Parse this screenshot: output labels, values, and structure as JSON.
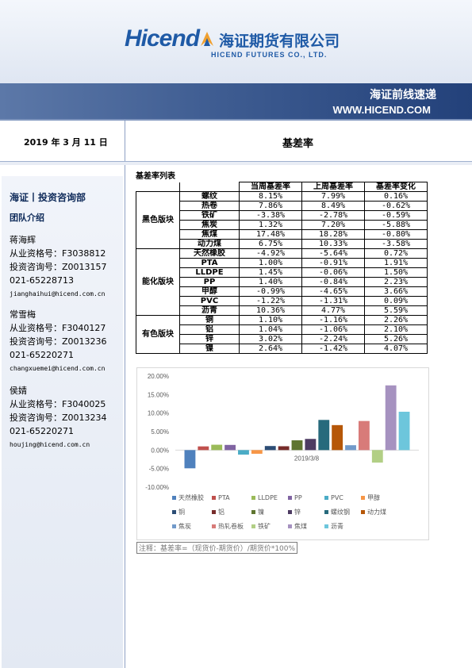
{
  "header": {
    "logo_en": "Hicend",
    "logo_cn": "海证期货有限公司",
    "logo_sub": "HICEND  FUTURES  CO.,  LTD.",
    "band_title": "海证前线速递",
    "band_url": "WWW.HICEND.COM"
  },
  "report": {
    "date": "2019 年 3 月 11 日",
    "title": "基差率"
  },
  "sidebar": {
    "dept": "海证丨投资咨询部",
    "team": "团队介绍",
    "members": [
      {
        "name": "蒋海辉",
        "qual": "从业资格号：F3038812",
        "consult": "投资咨询号：Z0013157",
        "phone": "021-65228713",
        "email": "jianghaihui@hicend.com.cn"
      },
      {
        "name": "常雪梅",
        "qual": "从业资格号：F3040127",
        "consult": "投资咨询号：Z0013236",
        "phone": "021-65220271",
        "email": "changxuemei@hicend.com.cn"
      },
      {
        "name": "侯婧",
        "qual": "从业资格号：F3040025",
        "consult": "投资咨询号：Z0013234",
        "phone": "021-65220271",
        "email": "houjing@hicend.com.cn"
      }
    ]
  },
  "table": {
    "title": "基差率列表",
    "headers": [
      "当周基差率",
      "上周基差率",
      "基差率变化"
    ],
    "groups": [
      {
        "name": "黑色版块",
        "rows": [
          {
            "name": "螺纹",
            "cur": "8.15%",
            "prev": "7.99%",
            "chg": "0.16%"
          },
          {
            "name": "热卷",
            "cur": "7.86%",
            "prev": "8.49%",
            "chg": "-0.62%"
          },
          {
            "name": "铁矿",
            "cur": "-3.38%",
            "prev": "-2.78%",
            "chg": "-0.59%"
          },
          {
            "name": "焦炭",
            "cur": "1.32%",
            "prev": "7.20%",
            "chg": "-5.88%"
          },
          {
            "name": "焦煤",
            "cur": "17.48%",
            "prev": "18.28%",
            "chg": "-0.80%"
          },
          {
            "name": "动力煤",
            "cur": "6.75%",
            "prev": "10.33%",
            "chg": "-3.58%"
          }
        ]
      },
      {
        "name": "能化版块",
        "rows": [
          {
            "name": "天然橡胶",
            "cur": "-4.92%",
            "prev": "-5.64%",
            "chg": "0.72%"
          },
          {
            "name": "PTA",
            "cur": "1.00%",
            "prev": "-0.91%",
            "chg": "1.91%"
          },
          {
            "name": "LLDPE",
            "cur": "1.45%",
            "prev": "-0.06%",
            "chg": "1.50%"
          },
          {
            "name": "PP",
            "cur": "1.40%",
            "prev": "-0.84%",
            "chg": "2.23%"
          },
          {
            "name": "甲醇",
            "cur": "-0.99%",
            "prev": "-4.65%",
            "chg": "3.66%"
          },
          {
            "name": "PVC",
            "cur": "-1.22%",
            "prev": "-1.31%",
            "chg": "0.09%"
          },
          {
            "name": "沥青",
            "cur": "10.36%",
            "prev": "4.77%",
            "chg": "5.59%"
          }
        ]
      },
      {
        "name": "有色版块",
        "rows": [
          {
            "name": "铜",
            "cur": "1.10%",
            "prev": "-1.16%",
            "chg": "2.26%"
          },
          {
            "name": "铝",
            "cur": "1.04%",
            "prev": "-1.06%",
            "chg": "2.10%"
          },
          {
            "name": "锌",
            "cur": "3.02%",
            "prev": "-2.24%",
            "chg": "5.26%"
          },
          {
            "name": "镍",
            "cur": "2.64%",
            "prev": "-1.42%",
            "chg": "4.07%"
          }
        ]
      }
    ]
  },
  "note": "注释：基差率=（现货价-期货价）/期货价*100%",
  "chart_data": {
    "type": "bar",
    "categories": [
      "2019/3/8"
    ],
    "ylim": [
      -10,
      20
    ],
    "yticks": [
      "20.00%",
      "15.00%",
      "10.00%",
      "5.00%",
      "0.00%",
      "-5.00%",
      "-10.00%"
    ],
    "yticks_values": [
      20,
      15,
      10,
      5,
      0,
      -5,
      -10
    ],
    "grid": false,
    "legend_position": "bottom",
    "series": [
      {
        "name": "天然橡胶",
        "values": [
          -4.92
        ],
        "color": "#4f81bd"
      },
      {
        "name": "PTA",
        "values": [
          1.0
        ],
        "color": "#c0504d"
      },
      {
        "name": "LLDPE",
        "values": [
          1.45
        ],
        "color": "#9bbb59"
      },
      {
        "name": "PP",
        "values": [
          1.4
        ],
        "color": "#8064a2"
      },
      {
        "name": "PVC",
        "values": [
          -1.22
        ],
        "color": "#4bacc6"
      },
      {
        "name": "甲醇",
        "values": [
          -0.99
        ],
        "color": "#f79646"
      },
      {
        "name": "铜",
        "values": [
          1.1
        ],
        "color": "#2c4d75"
      },
      {
        "name": "铝",
        "values": [
          1.04
        ],
        "color": "#772c2a"
      },
      {
        "name": "镍",
        "values": [
          2.64
        ],
        "color": "#5f7530"
      },
      {
        "name": "锌",
        "values": [
          3.02
        ],
        "color": "#4d3b62"
      },
      {
        "name": "螺纹钢",
        "values": [
          8.15
        ],
        "color": "#276a7c"
      },
      {
        "name": "动力煤",
        "values": [
          6.75
        ],
        "color": "#b65708"
      },
      {
        "name": "焦炭",
        "values": [
          1.32
        ],
        "color": "#729aca"
      },
      {
        "name": "热轧卷板",
        "values": [
          7.86
        ],
        "color": "#d87b79"
      },
      {
        "name": "铁矿",
        "values": [
          -3.38
        ],
        "color": "#b2cf85"
      },
      {
        "name": "焦煤",
        "values": [
          17.48
        ],
        "color": "#a692c0"
      },
      {
        "name": "沥青",
        "values": [
          10.36
        ],
        "color": "#6dc6dc"
      }
    ]
  }
}
